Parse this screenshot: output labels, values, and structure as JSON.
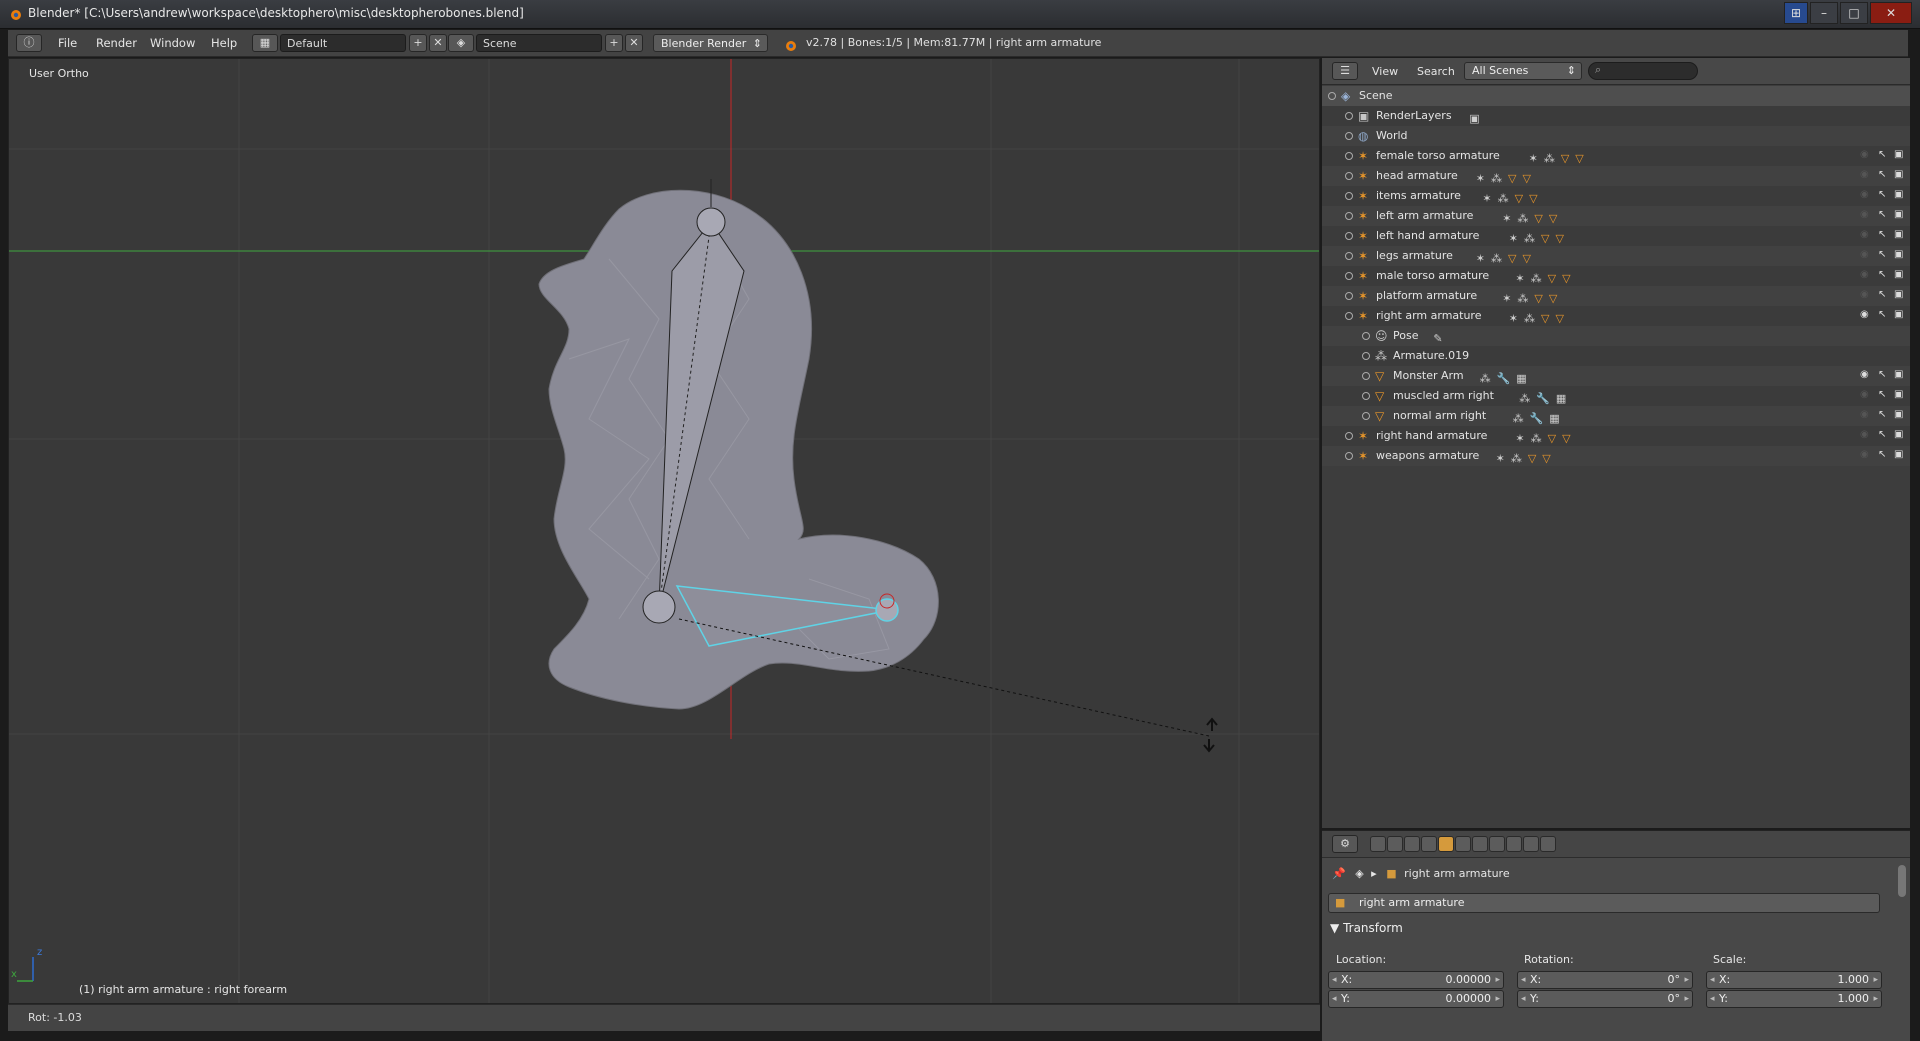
{
  "window": {
    "title": "Blender* [C:\\Users\\andrew\\workspace\\desktophero\\misc\\desktopherobones.blend]",
    "buttons": {
      "minimize": "–",
      "maximize": "□",
      "close": "✕"
    }
  },
  "info_bar": {
    "menus": [
      "File",
      "Render",
      "Window",
      "Help"
    ],
    "layout_value": "Default",
    "scene_value": "Scene",
    "engine_value": "Blender Render",
    "stats": "v2.78 | Bones:1/5 | Mem:81.77M | right arm armature"
  },
  "viewport": {
    "view_label": "User Ortho",
    "active_object_label": "(1) right arm armature : right forearm",
    "status_text": "Rot: -1.03",
    "axis_x": "x",
    "axis_z": "z"
  },
  "outliner": {
    "header": {
      "view_label": "View",
      "search_label": "Search",
      "scene_filter": "All Scenes",
      "search_placeholder": ""
    },
    "rows": [
      {
        "label": "Scene",
        "type": "scene",
        "indent": 0,
        "selected": true
      },
      {
        "label": "RenderLayers",
        "type": "renderlayers",
        "indent": 1
      },
      {
        "label": "World",
        "type": "world",
        "indent": 1
      },
      {
        "label": "female torso armature",
        "type": "armature",
        "indent": 1
      },
      {
        "label": "head armature",
        "type": "armature",
        "indent": 1
      },
      {
        "label": "items armature",
        "type": "armature",
        "indent": 1
      },
      {
        "label": "left arm armature",
        "type": "armature",
        "indent": 1
      },
      {
        "label": "left hand armature",
        "type": "armature",
        "indent": 1
      },
      {
        "label": "legs armature",
        "type": "armature",
        "indent": 1
      },
      {
        "label": "male torso armature",
        "type": "armature",
        "indent": 1
      },
      {
        "label": "platform armature",
        "type": "armature",
        "indent": 1
      },
      {
        "label": "right arm armature",
        "type": "armature",
        "indent": 1,
        "expanded": true,
        "active": true
      },
      {
        "label": "Pose",
        "type": "pose",
        "indent": 2
      },
      {
        "label": "Armature.019",
        "type": "armdata",
        "indent": 2
      },
      {
        "label": "Monster Arm",
        "type": "mesh",
        "indent": 2
      },
      {
        "label": "muscled arm right",
        "type": "mesh",
        "indent": 2
      },
      {
        "label": "normal arm right",
        "type": "mesh",
        "indent": 2
      },
      {
        "label": "right hand armature",
        "type": "armature",
        "indent": 1
      },
      {
        "label": "weapons armature",
        "type": "armature",
        "indent": 1
      }
    ]
  },
  "properties": {
    "context_object": "right arm armature",
    "object_name": "right arm armature",
    "panel_title": "Transform",
    "location_label": "Location:",
    "rotation_label": "Rotation:",
    "scale_label": "Scale:",
    "location": {
      "x_label": "X:",
      "x": "0.00000",
      "y_label": "Y:",
      "y": "0.00000"
    },
    "rotation": {
      "x_label": "X:",
      "x": "0°",
      "y_label": "Y:",
      "y": "0°"
    },
    "scale": {
      "x_label": "X:",
      "x": "1.000",
      "y_label": "Y:",
      "y": "1.000"
    }
  },
  "colors": {
    "accent_orange": "#d59a3c",
    "selection_cyan": "#5fd3e6",
    "axis_red": "#c62828",
    "axis_green": "#3ea63e"
  }
}
